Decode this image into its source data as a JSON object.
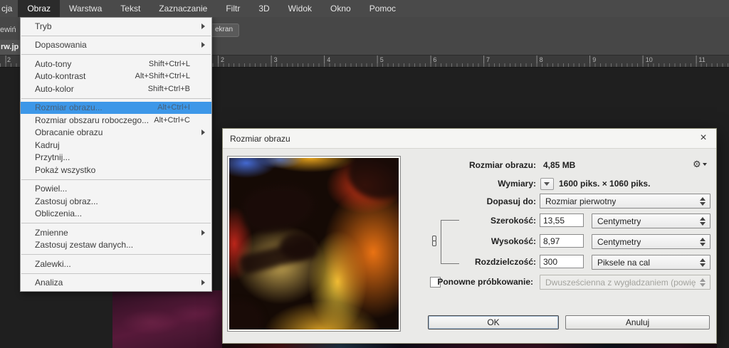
{
  "colors": {
    "accent_blue": "#3d97e8",
    "menubar_bg": "#4a4a4a",
    "canvas_bg": "#1f1f1f",
    "dialog_bg": "#eaeae8"
  },
  "menubar": {
    "items": [
      {
        "label": "cja",
        "active": false,
        "partial": true
      },
      {
        "label": "Obraz",
        "active": true
      },
      {
        "label": "Warstwa",
        "active": false
      },
      {
        "label": "Tekst",
        "active": false
      },
      {
        "label": "Zaznaczanie",
        "active": false
      },
      {
        "label": "Filtr",
        "active": false
      },
      {
        "label": "3D",
        "active": false
      },
      {
        "label": "Widok",
        "active": false
      },
      {
        "label": "Okno",
        "active": false
      },
      {
        "label": "Pomoc",
        "active": false
      }
    ]
  },
  "options_bar": {
    "ekran_button": "ekran",
    "scroll_fragment": "ewiń",
    "doc_tab_fragment": "rw.jp"
  },
  "ruler": {
    "left_number": "2",
    "numbers": [
      "2",
      "3",
      "4",
      "5",
      "6",
      "7",
      "8",
      "9",
      "10",
      "11"
    ]
  },
  "menu": {
    "items": [
      {
        "label": "Tryb",
        "submenu": true
      },
      {
        "separator": true
      },
      {
        "label": "Dopasowania",
        "submenu": true
      },
      {
        "separator": true
      },
      {
        "label": "Auto-tony",
        "shortcut": "Shift+Ctrl+L"
      },
      {
        "label": "Auto-kontrast",
        "shortcut": "Alt+Shift+Ctrl+L"
      },
      {
        "label": "Auto-kolor",
        "shortcut": "Shift+Ctrl+B"
      },
      {
        "separator": true
      },
      {
        "label": "Rozmiar obrazu...",
        "shortcut": "Alt+Ctrl+I",
        "highlighted": true
      },
      {
        "label": "Rozmiar obszaru roboczego...",
        "shortcut": "Alt+Ctrl+C"
      },
      {
        "label": "Obracanie obrazu",
        "submenu": true
      },
      {
        "label": "Kadruj"
      },
      {
        "label": "Przytnij..."
      },
      {
        "label": "Pokaż wszystko"
      },
      {
        "separator": true
      },
      {
        "label": "Powiel..."
      },
      {
        "label": "Zastosuj obraz..."
      },
      {
        "label": "Obliczenia..."
      },
      {
        "separator": true
      },
      {
        "label": "Zmienne",
        "submenu": true
      },
      {
        "label": "Zastosuj zestaw danych..."
      },
      {
        "separator": true
      },
      {
        "label": "Zalewki..."
      },
      {
        "separator": true
      },
      {
        "label": "Analiza",
        "submenu": true
      }
    ]
  },
  "dialog": {
    "title": "Rozmiar obrazu",
    "close_glyph": "×",
    "size_label": "Rozmiar obrazu:",
    "size_value": "4,85 MB",
    "dimensions_label": "Wymiary:",
    "dimensions_value": "1600 piks. × 1060 piks.",
    "fit_label": "Dopasuj do:",
    "fit_value": "Rozmiar pierwotny",
    "width_label": "Szerokość:",
    "width_value": "13,55",
    "width_unit": "Centymetry",
    "height_label": "Wysokość:",
    "height_value": "8,97",
    "height_unit": "Centymetry",
    "resolution_label": "Rozdzielczość:",
    "resolution_value": "300",
    "resolution_unit": "Piksele na cal",
    "resample_label": "Ponowne próbkowanie:",
    "resample_checked": false,
    "resample_value": "Dwusześcienna z wygładzaniem (powięk...",
    "ok_label": "OK",
    "cancel_label": "Anuluj"
  }
}
